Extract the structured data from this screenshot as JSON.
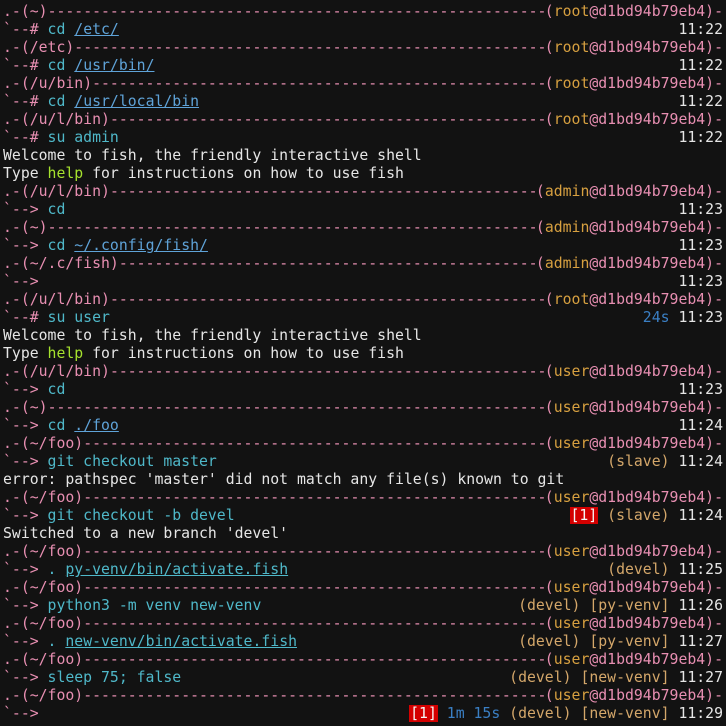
{
  "colors": {
    "background": "#121212",
    "prompt_frame": "#e88fb2",
    "user_host": "#d7a040",
    "command": "#4fb8c9",
    "error_badge": "#d40000",
    "duration": "#3a7fc4"
  },
  "lines": [
    {
      "type": "header",
      "cwd": "~",
      "user": "root",
      "host": "d1bd94b79eb4"
    },
    {
      "type": "prompt",
      "sym": "#",
      "segs": [
        {
          "t": "cd",
          "c": "cmd"
        },
        {
          "t": " "
        },
        {
          "t": "/etc/",
          "c": "blue",
          "u": 1
        }
      ],
      "time": "11:22"
    },
    {
      "type": "header",
      "cwd": "/etc",
      "user": "root",
      "host": "d1bd94b79eb4"
    },
    {
      "type": "prompt",
      "sym": "#",
      "segs": [
        {
          "t": "cd",
          "c": "cmd"
        },
        {
          "t": " "
        },
        {
          "t": "/usr/bin/",
          "c": "blue",
          "u": 1
        }
      ],
      "time": "11:22"
    },
    {
      "type": "header",
      "cwd": "/u/bin",
      "user": "root",
      "host": "d1bd94b79eb4"
    },
    {
      "type": "prompt",
      "sym": "#",
      "segs": [
        {
          "t": "cd",
          "c": "cmd"
        },
        {
          "t": " "
        },
        {
          "t": "/usr/local/bin",
          "c": "blue",
          "u": 1
        }
      ],
      "time": "11:22"
    },
    {
      "type": "header",
      "cwd": "/u/l/bin",
      "user": "root",
      "host": "d1bd94b79eb4"
    },
    {
      "type": "prompt",
      "sym": "#",
      "segs": [
        {
          "t": "su admin",
          "c": "cmd"
        }
      ],
      "time": "11:22"
    },
    {
      "type": "text",
      "segs": [
        {
          "t": "Welcome to fish, the friendly interactive shell"
        }
      ]
    },
    {
      "type": "text",
      "segs": [
        {
          "t": "Type "
        },
        {
          "t": "help",
          "c": "green"
        },
        {
          "t": " for instructions on how to use fish"
        }
      ]
    },
    {
      "type": "header",
      "cwd": "/u/l/bin",
      "user": "admin",
      "host": "d1bd94b79eb4"
    },
    {
      "type": "prompt",
      "sym": ">",
      "segs": [
        {
          "t": "cd",
          "c": "cmd"
        }
      ],
      "time": "11:23"
    },
    {
      "type": "header",
      "cwd": "~",
      "user": "admin",
      "host": "d1bd94b79eb4"
    },
    {
      "type": "prompt",
      "sym": ">",
      "segs": [
        {
          "t": "cd",
          "c": "cmd"
        },
        {
          "t": " "
        },
        {
          "t": "~/.config/fish/",
          "c": "blue",
          "u": 1
        }
      ],
      "time": "11:23"
    },
    {
      "type": "header",
      "cwd": "~/.c/fish",
      "user": "admin",
      "host": "d1bd94b79eb4"
    },
    {
      "type": "prompt",
      "sym": ">",
      "segs": [],
      "time": "11:23"
    },
    {
      "type": "header",
      "cwd": "/u/l/bin",
      "user": "root",
      "host": "d1bd94b79eb4"
    },
    {
      "type": "prompt",
      "sym": "#",
      "segs": [
        {
          "t": "su user",
          "c": "cmd"
        }
      ],
      "duration": "24s",
      "time": "11:23"
    },
    {
      "type": "text",
      "segs": [
        {
          "t": "Welcome to fish, the friendly interactive shell"
        }
      ]
    },
    {
      "type": "text",
      "segs": [
        {
          "t": "Type "
        },
        {
          "t": "help",
          "c": "green"
        },
        {
          "t": " for instructions on how to use fish"
        }
      ]
    },
    {
      "type": "header",
      "cwd": "/u/l/bin",
      "user": "user",
      "host": "d1bd94b79eb4"
    },
    {
      "type": "prompt",
      "sym": ">",
      "segs": [
        {
          "t": "cd",
          "c": "cmd"
        }
      ],
      "time": "11:23"
    },
    {
      "type": "header",
      "cwd": "~",
      "user": "user",
      "host": "d1bd94b79eb4"
    },
    {
      "type": "prompt",
      "sym": ">",
      "segs": [
        {
          "t": "cd",
          "c": "cmd"
        },
        {
          "t": " "
        },
        {
          "t": "./foo",
          "c": "blue",
          "u": 1
        }
      ],
      "time": "11:24"
    },
    {
      "type": "header",
      "cwd": "~/foo",
      "user": "user",
      "host": "d1bd94b79eb4"
    },
    {
      "type": "prompt",
      "sym": ">",
      "segs": [
        {
          "t": "git checkout master",
          "c": "cmd"
        }
      ],
      "git": "(slave)",
      "time": "11:24"
    },
    {
      "type": "text",
      "segs": [
        {
          "t": "error: pathspec 'master' did not match any file(s) known to git"
        }
      ]
    },
    {
      "type": "header",
      "cwd": "~/foo",
      "user": "user",
      "host": "d1bd94b79eb4"
    },
    {
      "type": "prompt",
      "sym": ">",
      "segs": [
        {
          "t": "git checkout -b devel",
          "c": "cmd"
        }
      ],
      "status": "[1]",
      "git": "(slave)",
      "time": "11:24"
    },
    {
      "type": "text",
      "segs": [
        {
          "t": "Switched to a new branch 'devel'"
        }
      ]
    },
    {
      "type": "header",
      "cwd": "~/foo",
      "user": "user",
      "host": "d1bd94b79eb4"
    },
    {
      "type": "prompt",
      "sym": ">",
      "segs": [
        {
          "t": ".",
          "c": "cmd"
        },
        {
          "t": " "
        },
        {
          "t": "py-venv/bin/activate.fish",
          "c": "cmd",
          "u": 1
        }
      ],
      "git": "(devel)",
      "time": "11:25"
    },
    {
      "type": "header",
      "cwd": "~/foo",
      "user": "user",
      "host": "d1bd94b79eb4"
    },
    {
      "type": "prompt",
      "sym": ">",
      "segs": [
        {
          "t": "python3 -m venv new-venv",
          "c": "cmd"
        }
      ],
      "git": "(devel)",
      "venv": "[py-venv]",
      "time": "11:26"
    },
    {
      "type": "header",
      "cwd": "~/foo",
      "user": "user",
      "host": "d1bd94b79eb4"
    },
    {
      "type": "prompt",
      "sym": ">",
      "segs": [
        {
          "t": ".",
          "c": "cmd"
        },
        {
          "t": " "
        },
        {
          "t": "new-venv/bin/activate.fish",
          "c": "cmd",
          "u": 1
        }
      ],
      "git": "(devel)",
      "venv": "[py-venv]",
      "time": "11:27"
    },
    {
      "type": "header",
      "cwd": "~/foo",
      "user": "user",
      "host": "d1bd94b79eb4"
    },
    {
      "type": "prompt",
      "sym": ">",
      "segs": [
        {
          "t": "sleep 75; false",
          "c": "cmd"
        }
      ],
      "git": "(devel)",
      "venv": "[new-venv]",
      "time": "11:27"
    },
    {
      "type": "header",
      "cwd": "~/foo",
      "user": "user",
      "host": "d1bd94b79eb4"
    },
    {
      "type": "prompt",
      "sym": ">",
      "segs": [],
      "status": "[1]",
      "duration": "1m 15s",
      "git": "(devel)",
      "venv": "[new-venv]",
      "time": "11:29"
    }
  ]
}
